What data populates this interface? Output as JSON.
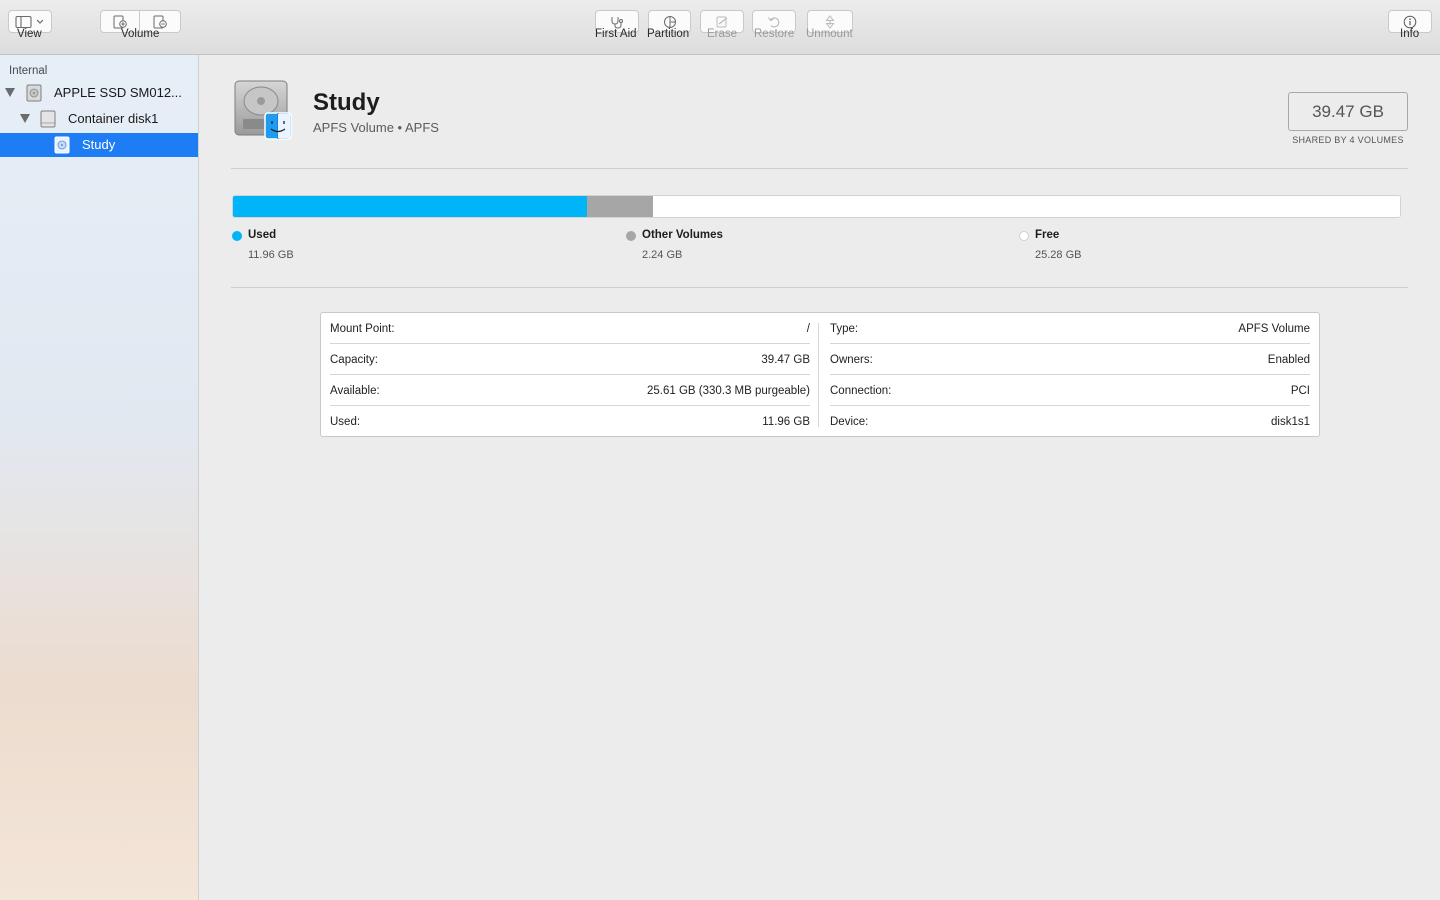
{
  "toolbar": {
    "view_label": "View",
    "volume_label": "Volume",
    "first_aid_label": "First Aid",
    "partition_label": "Partition",
    "erase_label": "Erase",
    "restore_label": "Restore",
    "unmount_label": "Unmount",
    "info_label": "Info"
  },
  "sidebar": {
    "section": "Internal",
    "items": [
      {
        "label": "APPLE SSD SM012...",
        "icon": "internal-disk-icon"
      },
      {
        "label": "Container disk1",
        "icon": "container-icon"
      },
      {
        "label": "Study",
        "icon": "volume-icon",
        "selected": true
      }
    ]
  },
  "volume": {
    "name": "Study",
    "subtitle": "APFS Volume • APFS",
    "capacity": "39.47 GB",
    "shared_note": "SHARED BY 4 VOLUMES"
  },
  "usage": {
    "total_gb": 39.47,
    "segments": [
      {
        "name": "Used",
        "value": "11.96 GB",
        "gb": 11.96,
        "color": "#00b4f8"
      },
      {
        "name": "Other Volumes",
        "value": "2.24 GB",
        "gb": 2.24,
        "color": "#a6a6a6"
      },
      {
        "name": "Free",
        "value": "25.28 GB",
        "gb": 25.28,
        "color": "#ffffff"
      }
    ]
  },
  "info": {
    "left": [
      {
        "key": "Mount Point:",
        "value": "/"
      },
      {
        "key": "Capacity:",
        "value": "39.47 GB"
      },
      {
        "key": "Available:",
        "value": "25.61 GB (330.3 MB purgeable)"
      },
      {
        "key": "Used:",
        "value": "11.96 GB"
      }
    ],
    "right": [
      {
        "key": "Type:",
        "value": "APFS Volume"
      },
      {
        "key": "Owners:",
        "value": "Enabled"
      },
      {
        "key": "Connection:",
        "value": "PCI"
      },
      {
        "key": "Device:",
        "value": "disk1s1"
      }
    ]
  }
}
